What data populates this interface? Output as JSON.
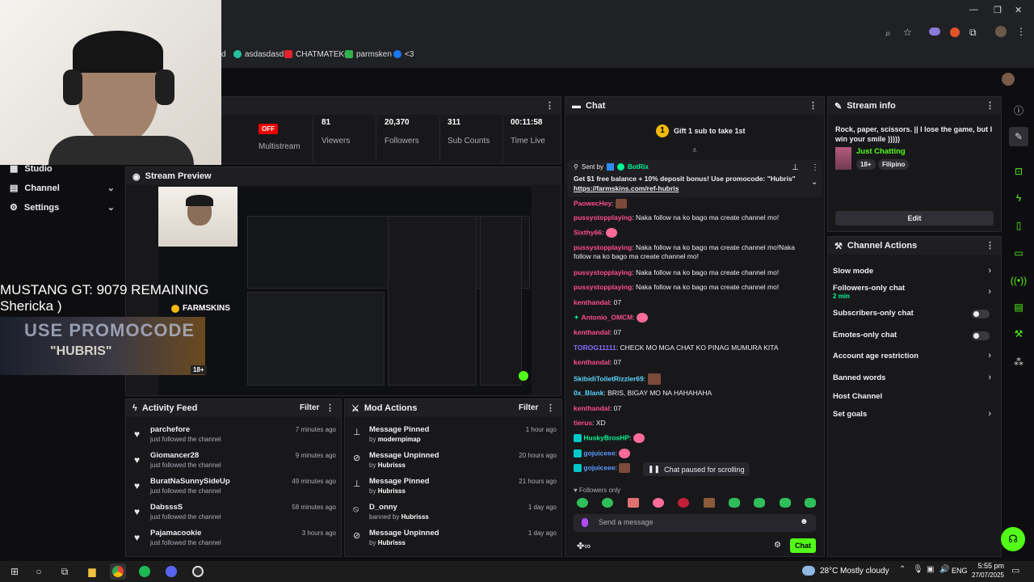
{
  "browser": {
    "bookmarks": [
      {
        "label": "d"
      },
      {
        "label": "asdasdasd"
      },
      {
        "label": "CHATMATEKO"
      },
      {
        "label": "parmsken"
      },
      {
        "label": "<3"
      }
    ]
  },
  "stats": {
    "multistream_badge": "OFF",
    "multistream_label": "Multistream",
    "viewers_value": "81",
    "viewers_label": "Viewers",
    "followers_value": "20,370",
    "followers_label": "Followers",
    "subs_value": "311",
    "subs_label": "Sub Counts",
    "time_value": "00:11:58",
    "time_label": "Time Live"
  },
  "nav": {
    "studio": "Studio",
    "channel": "Channel",
    "settings": "Settings"
  },
  "stream_preview": {
    "title": "Stream Preview"
  },
  "overlay": {
    "line1": "MUSTANG GT: 9079 REMAINING",
    "line2": "Shericka  )",
    "promo_top": "USE PROMOCODE",
    "promo_bottom": "\"HUBRIS\"",
    "farmskins": "FARMSKINS",
    "age_badge": "18+"
  },
  "activity": {
    "title": "Activity Feed",
    "filter": "Filter",
    "items": [
      {
        "name": "parchefore",
        "sub": "just followed the channel",
        "time": "7 minutes ago"
      },
      {
        "name": "Giomancer28",
        "sub": "just followed the channel",
        "time": "9 minutes ago"
      },
      {
        "name": "BuratNaSunnySideUp",
        "sub": "just followed the channel",
        "time": "49 minutes ago"
      },
      {
        "name": "DabsssS",
        "sub": "just followed the channel",
        "time": "58 minutes ago"
      },
      {
        "name": "Pajamacookie",
        "sub": "just followed the channel",
        "time": "3 hours ago"
      }
    ]
  },
  "mod_actions": {
    "title": "Mod Actions",
    "filter": "Filter",
    "items": [
      {
        "action": "Message Pinned",
        "by": "by",
        "user": "modernpimap",
        "time": "1 hour ago"
      },
      {
        "action": "Message Unpinned",
        "by": "by",
        "user": "Hubrisss",
        "time": "20 hours ago"
      },
      {
        "action": "Message Pinned",
        "by": "by",
        "user": "Hubrisss",
        "time": "21 hours ago"
      },
      {
        "action": "D_onny",
        "by": "banned by",
        "user": "Hubrisss",
        "time": "1 day ago"
      },
      {
        "action": "Message Unpinned",
        "by": "by",
        "user": "Hubrisss",
        "time": "1 day ago"
      }
    ]
  },
  "chat": {
    "title": "Chat",
    "gift_count": "1",
    "gift_text": "Gift 1 sub to take 1st",
    "pinned_sent_by": "Sent by",
    "pinned_user": "BotRix",
    "pinned_text": "Get $1 free balance + 10% deposit bonus! Use promocode: \"Hubris\"",
    "pinned_link": "https://farmskins.com/ref-hubris",
    "messages": [
      {
        "user": "PaowecHey",
        "text": "",
        "color": "#ff4d8a"
      },
      {
        "user": "pussystopplaying",
        "text": "Naka follow na ko bago ma create channel mo!",
        "color": "#ff4d8a"
      },
      {
        "user": "Sixthy66",
        "text": "",
        "color": "#ff4d8a"
      },
      {
        "user": "pussystopplaying",
        "text": "Naka follow na ko bago ma create channel mo!Naka follow na ko bago ma create channel mo!",
        "color": "#ff4d8a"
      },
      {
        "user": "pussystopplaying",
        "text": "Naka follow na ko bago ma create channel mo!",
        "color": "#ff4d8a"
      },
      {
        "user": "pussystopplaying",
        "text": "Naka follow na ko bago ma create channel mo!",
        "color": "#ff4d8a"
      },
      {
        "user": "kenthandal",
        "text": "07",
        "color": "#ff4d8a"
      },
      {
        "user": "Antonio_OMCM",
        "text": "",
        "color": "#ff4d8a"
      },
      {
        "user": "kenthandal",
        "text": "07",
        "color": "#ff4d8a"
      },
      {
        "user": "TOROG11111",
        "text": "CHECK MO MGA CHAT KO PINAG MUMURA KITA",
        "color": "#8a6bff"
      },
      {
        "user": "kenthandal",
        "text": "07",
        "color": "#ff4d8a"
      },
      {
        "user": "SkibidiToiletRizzler69",
        "text": "",
        "color": "#5cd6ff"
      },
      {
        "user": "0x_Blank",
        "text": "BRIS, BIGAY MO NA HAHAHAHA",
        "color": "#5cd6ff"
      },
      {
        "user": "kenthandal",
        "text": "07",
        "color": "#ff4d8a"
      },
      {
        "user": "tierus",
        "text": "XD",
        "color": "#ff4d8a"
      },
      {
        "user": "HuskyBrosHP",
        "text": "",
        "color": "#00f593"
      },
      {
        "user": "gojuiceee",
        "text": "",
        "color": "#5c9bff"
      },
      {
        "user": "gojuiceee",
        "text": "",
        "color": "#5c9bff"
      }
    ],
    "paused": "Chat paused for scrolling",
    "followers_only": "Followers only",
    "placeholder": "Send a message",
    "send": "Chat"
  },
  "stream_info": {
    "title": "Stream info",
    "description": "Rock, paper, scissors. || I lose the game, but I win your smile )))))",
    "category": "Just Chatting",
    "tag1": "18+",
    "tag2": "Filipino",
    "edit": "Edit"
  },
  "channel_actions": {
    "title": "Channel Actions",
    "slow_mode": "Slow mode",
    "followers_only": "Followers-only chat",
    "followers_only_sub": "2 min",
    "subscribers_only": "Subscribers-only chat",
    "emotes_only": "Emotes-only chat",
    "age_restriction": "Account age restriction",
    "banned_words": "Banned words",
    "host_channel": "Host Channel",
    "set_goals": "Set goals"
  },
  "taskbar": {
    "temp": "28°C",
    "weather": "Mostly cloudy",
    "lang": "ENG",
    "time": "5:55 pm",
    "date": "27/07/2025"
  },
  "colors": {
    "accent": "#53fc18",
    "panel": "#18181b",
    "bg": "#0e0e10"
  }
}
